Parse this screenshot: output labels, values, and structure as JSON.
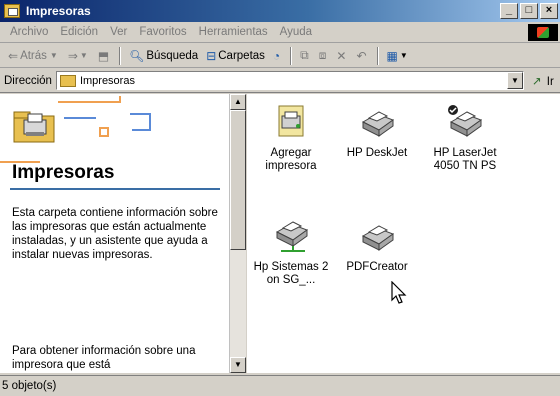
{
  "window": {
    "title": "Impresoras"
  },
  "menu": [
    "Archivo",
    "Edición",
    "Ver",
    "Favoritos",
    "Herramientas",
    "Ayuda"
  ],
  "toolbar": {
    "back": "Atrás",
    "search": "Búsqueda",
    "folders": "Carpetas"
  },
  "address": {
    "label": "Dirección",
    "value": "Impresoras",
    "go": "Ir"
  },
  "left_panel": {
    "title": "Impresoras",
    "description": "Esta carpeta contiene información sobre las impresoras que están actualmente instaladas, y un asistente que ayuda a instalar nuevas impresoras.",
    "more": "Para obtener información sobre una impresora que está"
  },
  "items": [
    {
      "label": "Agregar impresora",
      "icon": "add-printer-icon"
    },
    {
      "label": "HP DeskJet",
      "icon": "printer-icon"
    },
    {
      "label": "HP LaserJet 4050 TN PS",
      "icon": "default-printer-icon"
    },
    {
      "label": "Hp Sistemas 2 on SG_...",
      "icon": "network-printer-icon"
    },
    {
      "label": "PDFCreator",
      "icon": "printer-icon"
    }
  ],
  "status": {
    "text": "5 objeto(s)"
  }
}
